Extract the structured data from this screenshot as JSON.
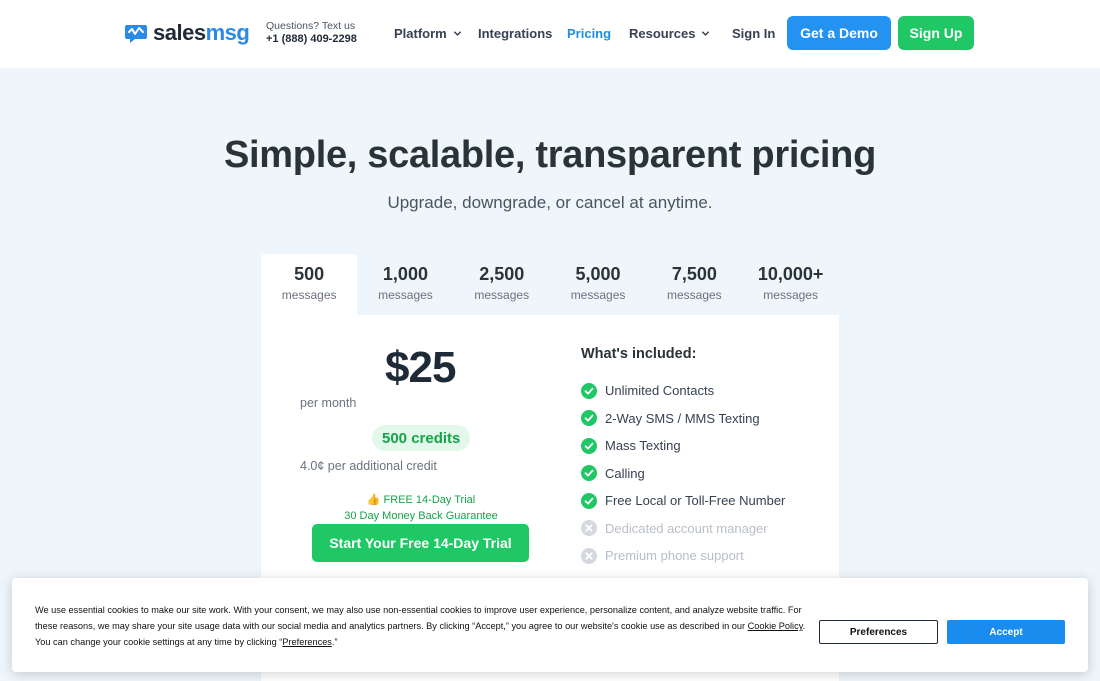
{
  "header": {
    "logo_prefix": "sales",
    "logo_suffix": "msg",
    "contact_question": "Questions? Text us",
    "contact_phone": "+1 (888) 409-2298",
    "nav": {
      "platform": "Platform",
      "integrations": "Integrations",
      "pricing": "Pricing",
      "resources": "Resources",
      "sign_in": "Sign In"
    },
    "demo_button": "Get a Demo",
    "signup_button": "Sign Up",
    "colors": {
      "brand_blue": "#2392f1",
      "brand_green": "#1fc765",
      "active_nav": "#1d8fe1"
    }
  },
  "hero": {
    "title": "Simple, scalable, transparent pricing",
    "subtitle": "Upgrade, downgrade, or cancel at anytime."
  },
  "tabs": [
    {
      "value": "500",
      "label": "messages",
      "selected": true
    },
    {
      "value": "1,000",
      "label": "messages",
      "selected": false
    },
    {
      "value": "2,500",
      "label": "messages",
      "selected": false
    },
    {
      "value": "5,000",
      "label": "messages",
      "selected": false
    },
    {
      "value": "7,500",
      "label": "messages",
      "selected": false
    },
    {
      "value": "10,000+",
      "label": "messages",
      "selected": false
    }
  ],
  "plan": {
    "price": "$25",
    "period": "per month",
    "credits": "500 credits",
    "additional_credit": "4.0¢ per additional credit",
    "trial_emoji": "👍",
    "trial_text": "FREE 14-Day Trial",
    "money_back": "30 Day Money Back Guarantee",
    "cta": "Start Your Free 14-Day Trial"
  },
  "included": {
    "title": "What's included:",
    "features": [
      {
        "label": "Unlimited Contacts",
        "included": true,
        "icon": "check-circle-icon"
      },
      {
        "label": "2-Way SMS / MMS Texting",
        "included": true,
        "icon": "check-circle-icon"
      },
      {
        "label": "Mass Texting",
        "included": true,
        "icon": "check-circle-icon"
      },
      {
        "label": "Calling",
        "included": true,
        "icon": "check-circle-icon"
      },
      {
        "label": "Free Local or Toll-Free Number",
        "included": true,
        "icon": "check-circle-icon"
      },
      {
        "label": "Dedicated account manager",
        "included": false,
        "icon": "x-circle-icon"
      },
      {
        "label": "Premium phone support",
        "included": false,
        "icon": "x-circle-icon"
      }
    ]
  },
  "cookie": {
    "text_1": "We use essential cookies to make our site work. With your consent, we may also use non-essential cookies to improve user experience, personalize content, and analyze website traffic. For these reasons, we may share your site usage data with our social media and analytics partners. By clicking “Accept,” you agree to our website's cookie use as described in our ",
    "policy_link": "Cookie Policy",
    "text_2": ". You can change your cookie settings at any time by clicking “",
    "preferences_link": "Preferences",
    "text_3": ".”",
    "preferences_button": "Preferences",
    "accept_button": "Accept"
  }
}
